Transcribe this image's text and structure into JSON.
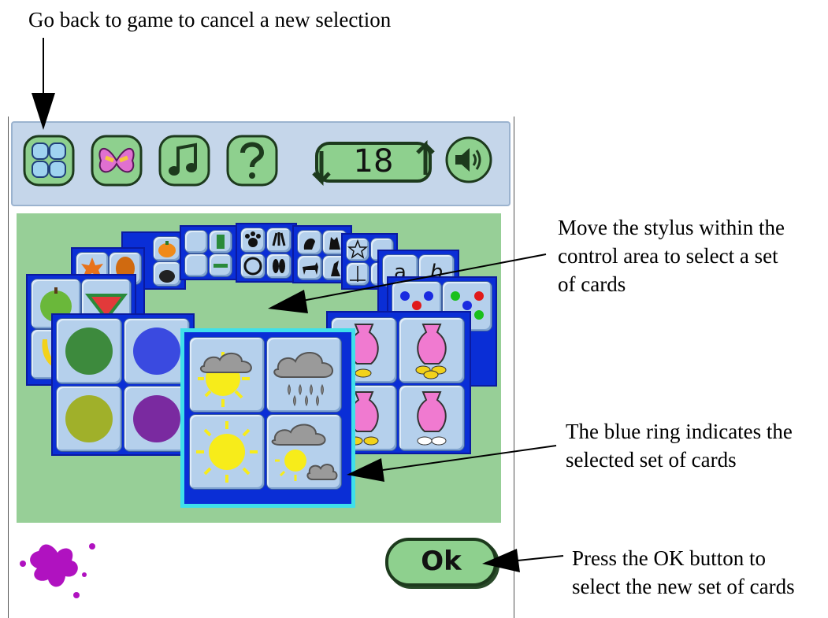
{
  "callouts": {
    "back": "Go back to game to cancel a new selection",
    "stylus": "Move the stylus within the\ncontrol area to select a set\nof cards",
    "ring": "The blue ring indicates the\nselected set of cards",
    "ok": "Press the OK button to\nselect the new set of cards"
  },
  "toolbar": {
    "buttons": [
      {
        "name": "sets-icon"
      },
      {
        "name": "butterfly-icon"
      },
      {
        "name": "music-icon"
      },
      {
        "name": "help-icon"
      }
    ],
    "counter_value": "18",
    "sound": "speaker-icon"
  },
  "ok_button": {
    "label": "Ok"
  },
  "colors": {
    "toolbar": "#c5d6ea",
    "play_area": "#97cf97",
    "ring": "#3fe0ea",
    "set_bg": "#0a2ed6",
    "button_green": "#8ed08e"
  }
}
